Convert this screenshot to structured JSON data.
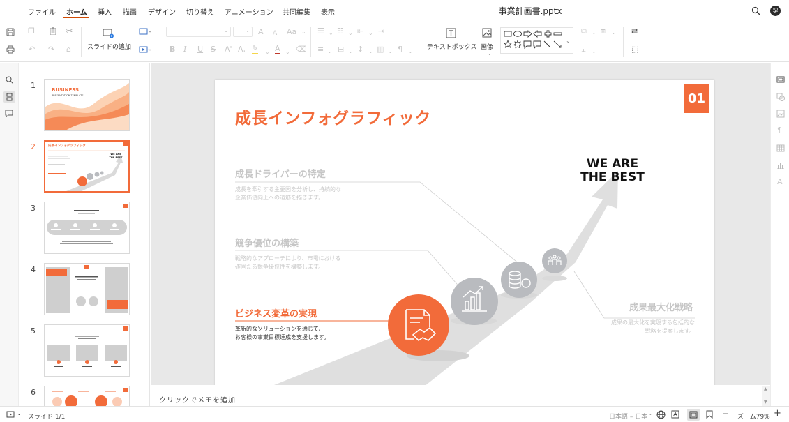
{
  "app": {
    "document_title": "事業計画書.pptx",
    "user_initial": "契"
  },
  "menu": {
    "items": [
      "ファイル",
      "ホーム",
      "挿入",
      "描画",
      "デザイン",
      "切り替え",
      "アニメーション",
      "共同編集",
      "表示"
    ],
    "active": "ホーム"
  },
  "ribbon": {
    "add_slide": "スライドの追加",
    "text_box": "テキストボックス",
    "image": "画像"
  },
  "thumbnails": {
    "numbers": [
      "1",
      "2",
      "3",
      "4",
      "5",
      "6"
    ],
    "selected": "2",
    "t1_title": "BUSINESS",
    "t1_subtitle": "PRESENTATION TEMPLATE",
    "t2_title": "成長インフォグラフィック",
    "t2_best": "WE ARE THE BEST"
  },
  "slide": {
    "badge": "01",
    "title": "成長インフォグラフィック",
    "best_line1": "WE ARE",
    "best_line2": "THE BEST",
    "items": [
      {
        "heading": "成長ドライバーの特定",
        "desc1": "成長を牽引する主要因を分析し、持続的な",
        "desc2": "企業価値向上への道筋を描きます。"
      },
      {
        "heading": "競争優位の構築",
        "desc1": "戦略的なアプローチにより、市場における",
        "desc2": "確固たる競争優位性を構築します。"
      },
      {
        "heading": "ビジネス変革の実現",
        "desc1": "革新的なソリューションを通じて、",
        "desc2": "お客様の事業目標達成を支援します。"
      },
      {
        "heading": "成果最大化戦略",
        "desc1": "成果の最大化を実現する包括的な",
        "desc2": "戦略を提案します。"
      }
    ]
  },
  "notes": {
    "placeholder": "クリックでメモを追加"
  },
  "status": {
    "slide_indicator": "スライド 1/1",
    "language": "日本語 – 日本",
    "zoom": "ズーム79%"
  },
  "colors": {
    "accent": "#f26b3a",
    "menu_underline": "#d04a02",
    "gray_circle": "#b9bbbf"
  }
}
